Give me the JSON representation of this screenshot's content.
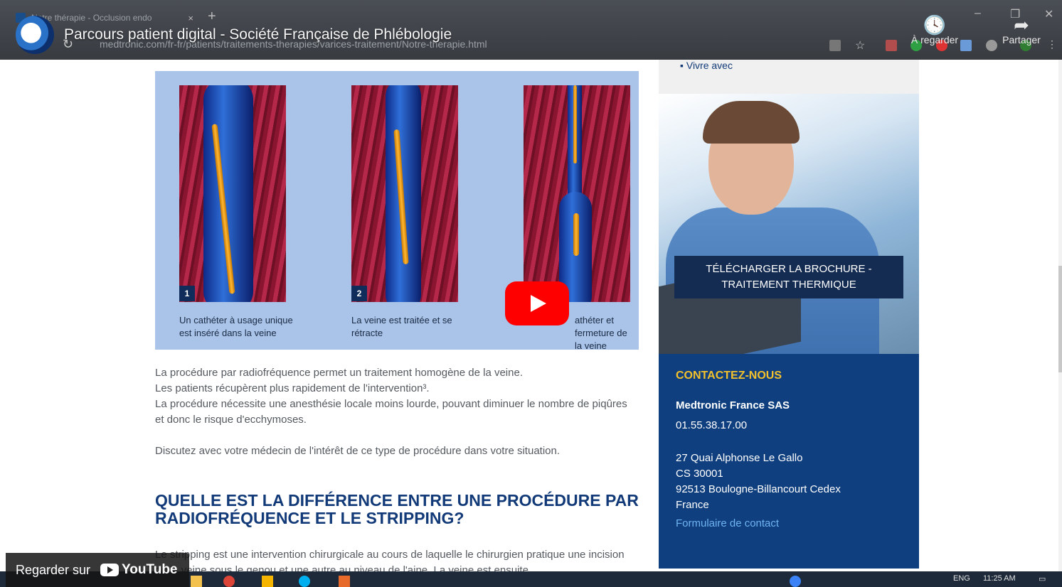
{
  "browser": {
    "tab_title": "Notre thérapie - Occlusion endo",
    "tab_close": "×",
    "new_tab": "+",
    "url": "medtronic.com/fr-fr/patients/traitements-therapies/varices-traitement/Notre-therapie.html"
  },
  "youtube": {
    "video_title": "Parcours patient digital - Société Française de Phlébologie",
    "watch_later_label": "À regarder",
    "share_label": "Partager",
    "watch_on_label": "Regarder sur",
    "brand": "YouTube"
  },
  "sidebar": {
    "nav_item": "Vivre avec",
    "brochure_button": "TÉLÉCHARGER LA BROCHURE - TRAITEMENT THERMIQUE",
    "contact": {
      "title": "CONTACTEZ-NOUS",
      "company": "Medtronic France SAS",
      "phone": "01.55.38.17.00",
      "address_line1": "27 Quai Alphonse Le Gallo",
      "address_line2": "CS 30001",
      "address_line3": "92513 Boulogne-Billancourt Cedex",
      "address_line4": "France",
      "form_link": "Formulaire de contact"
    }
  },
  "illustration": {
    "steps": [
      {
        "number": "1",
        "caption": "Un cathéter à usage unique est inséré dans la veine"
      },
      {
        "number": "2",
        "caption": "La veine est traitée et se rétracte"
      },
      {
        "number": "3",
        "caption": "athéter et fermeture de la veine"
      }
    ]
  },
  "content": {
    "para1_line1": "La procédure par radiofréquence permet un traitement homogène de la veine.",
    "para1_line2": "Les patients récupèrent plus rapidement de l'intervention³.",
    "para1_line3": "La procédure nécessite une anesthésie locale moins lourde, pouvant diminuer le nombre de piqûres et donc le risque d'ecchymoses.",
    "para2": "Discutez avec votre médecin de l'intérêt de ce type de procédure dans votre situation.",
    "heading": "QUELLE EST LA DIFFÉRENCE ENTRE UNE PROCÉDURE PAR RADIOFRÉQUENCE ET LE STRIPPING?",
    "para3": "Le stripping est une intervention chirurgicale au cours de laquelle le chirurgien pratique une incision de la veine sous le genou et une autre au niveau de l'aine. La veine est ensuite"
  },
  "taskbar": {
    "lang": "ENG",
    "time": "11:25 AM"
  }
}
